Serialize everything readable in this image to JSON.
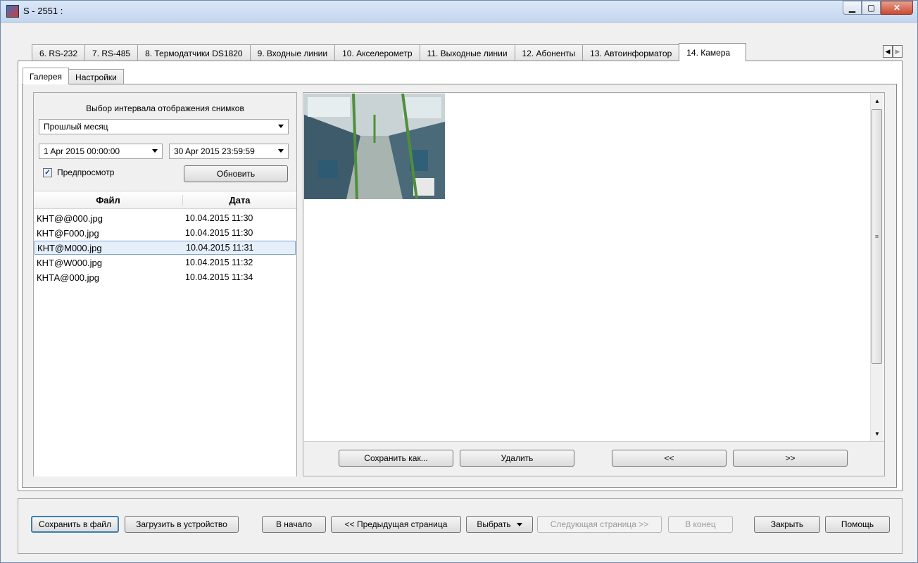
{
  "window": {
    "title": "S - 2551 :"
  },
  "tabs": [
    "6. RS-232",
    "7. RS-485",
    "8. Термодатчики DS1820",
    "9. Входные линии",
    "10. Акселерометр",
    "11. Выходные линии",
    "12. Абоненты",
    "13. Автоинформатор",
    "14. Камера"
  ],
  "active_tab": "14. Камера",
  "subtabs": [
    "Галерея",
    "Настройки"
  ],
  "filter": {
    "label": "Выбор интервала отображения снимков",
    "period": "Прошлый месяц",
    "date_from": "1 Apr 2015 00:00:00",
    "date_to": "30 Apr 2015 23:59:59",
    "preview_label": "Предпросмотр",
    "preview_checked": true,
    "refresh_label": "Обновить"
  },
  "file_list": {
    "headers": {
      "file": "Файл",
      "date": "Дата"
    },
    "rows": [
      {
        "file": "КНТ@@000.jpg",
        "date": "10.04.2015 11:30"
      },
      {
        "file": "КНТ@F000.jpg",
        "date": "10.04.2015 11:30"
      },
      {
        "file": "КНТ@M000.jpg",
        "date": "10.04.2015 11:31"
      },
      {
        "file": "КНТ@W000.jpg",
        "date": "10.04.2015 11:32"
      },
      {
        "file": "КНТА@000.jpg",
        "date": "10.04.2015 11:34"
      }
    ],
    "selected_index": 2
  },
  "gallery_buttons": {
    "save_as": "Сохранить как...",
    "delete": "Удалить",
    "prev": "<<",
    "next": ">>"
  },
  "bottom": {
    "save_file": "Сохранить в файл",
    "upload": "Загрузить в устройство",
    "first": "В начало",
    "prev_page": "<< Предыдущая страница",
    "select": "Выбрать",
    "next_page": "Следующая страница >>",
    "last": "В конец",
    "close": "Закрыть",
    "help": "Помощь"
  }
}
